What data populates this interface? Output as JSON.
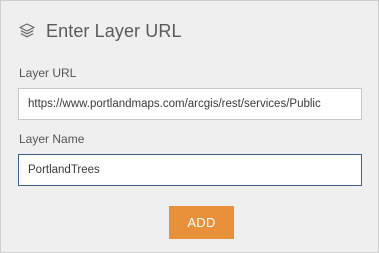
{
  "dialog": {
    "title": "Enter Layer URL",
    "header_icon": "layers-icon"
  },
  "layer_url": {
    "label": "Layer URL",
    "value": "https://www.portlandmaps.com/arcgis/rest/services/Public"
  },
  "layer_name": {
    "label": "Layer Name",
    "value": "PortlandTrees"
  },
  "actions": {
    "add_label": "ADD"
  },
  "colors": {
    "panel_background": "#efefef",
    "accent_button": "#e8913a",
    "focused_border": "#3e5f8a"
  }
}
